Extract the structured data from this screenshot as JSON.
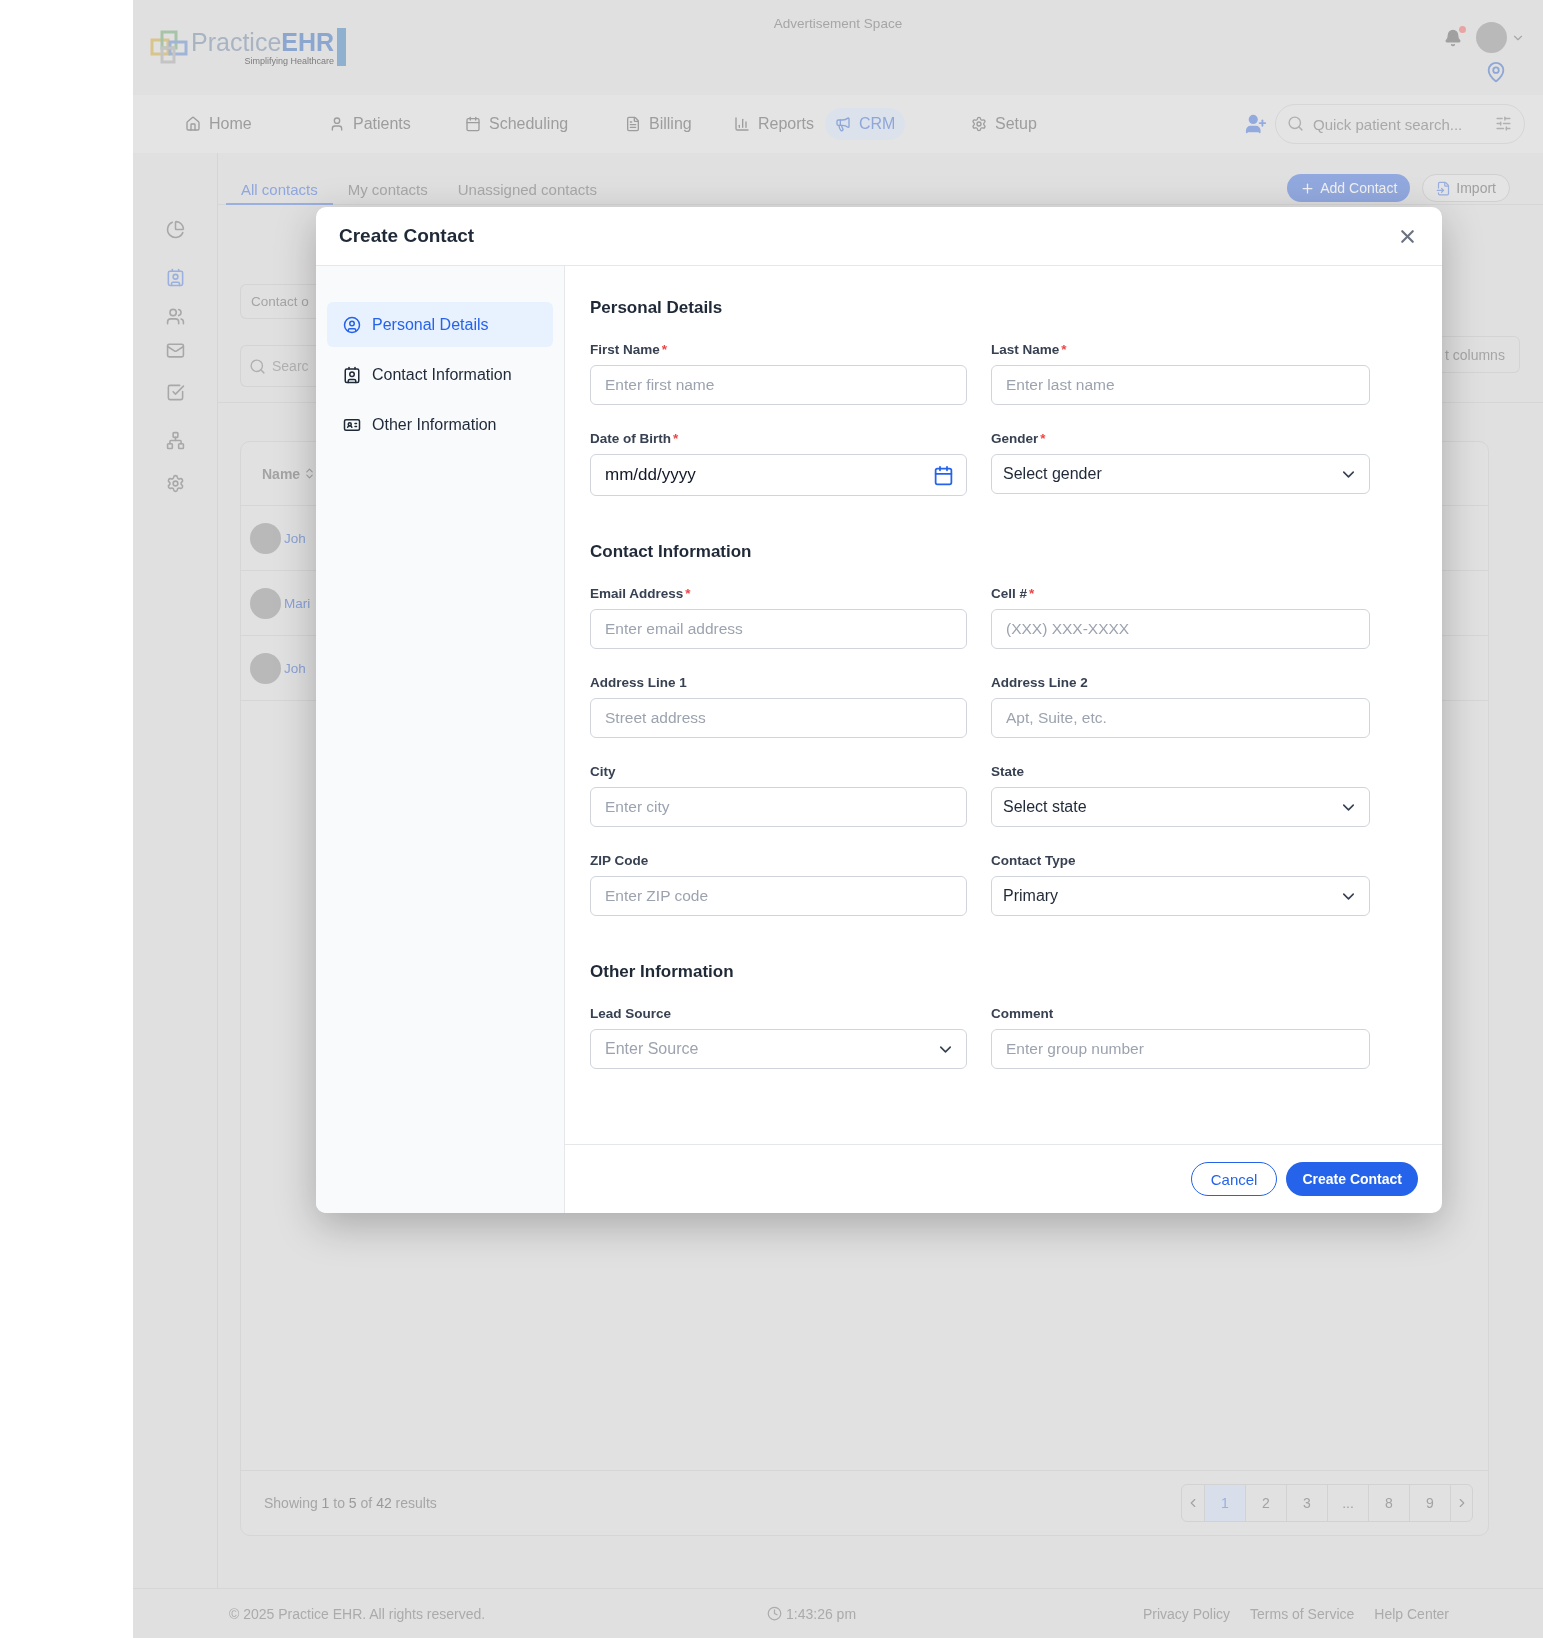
{
  "app_header": {
    "logo": {
      "name": "Practice**EHR**",
      "tagline": "Simplifying Healthcare"
    },
    "ad_text": "Advertisement Space",
    "notifications": {
      "unread": true
    }
  },
  "nav": {
    "items": [
      {
        "label": "Home",
        "selected": false
      },
      {
        "label": "Patients",
        "selected": false
      },
      {
        "label": "Scheduling",
        "selected": false
      },
      {
        "label": "Billing",
        "selected": false
      },
      {
        "label": "Reports",
        "selected": false
      },
      {
        "label": "CRM",
        "selected": true
      },
      {
        "label": "Setup",
        "selected": false
      }
    ],
    "search": {
      "placeholder": "Quick patient search..."
    }
  },
  "sidebar": {
    "items": [
      {
        "selected": false
      },
      {
        "selected": true
      },
      {
        "selected": false
      },
      {
        "selected": false
      },
      {
        "selected": false
      },
      {
        "selected": false
      },
      {
        "selected": false
      }
    ]
  },
  "contacts_page": {
    "tabs": [
      {
        "label": "All contacts",
        "selected": true
      },
      {
        "label": "My contacts",
        "selected": false
      },
      {
        "label": "Unassigned contacts",
        "selected": false
      }
    ],
    "actions": [
      {
        "label": "Add Contact",
        "kind": "primary"
      },
      {
        "label": "Import",
        "kind": "secondary"
      }
    ],
    "filter_field": "Contact o",
    "search_placeholder": "Searc",
    "columns_button": "t columns",
    "table": {
      "columns": [
        "Name"
      ],
      "rows": [
        {
          "name": "Joh"
        },
        {
          "name": "Mari"
        },
        {
          "name": "Joh"
        }
      ],
      "summary": "Showing **1** to **5** of **42** results",
      "pages": [
        {
          "label": "1",
          "selected": true
        },
        {
          "label": "2",
          "selected": false
        },
        {
          "label": "3",
          "selected": false
        },
        {
          "label": "...",
          "selected": false
        },
        {
          "label": "8",
          "selected": false
        },
        {
          "label": "9",
          "selected": false
        }
      ]
    }
  },
  "footer": {
    "copyright": "© 2025 Practice EHR. All rights reserved.",
    "time": "1:43:26 pm",
    "links": [
      "Privacy Policy",
      "Terms of Service",
      "Help Center"
    ]
  },
  "modal": {
    "title": "Create Contact",
    "nav": [
      {
        "label": "Personal Details",
        "selected": true
      },
      {
        "label": "Contact Information",
        "selected": false
      },
      {
        "label": "Other Information",
        "selected": false
      }
    ],
    "sections": [
      {
        "title": "Personal Details",
        "fields": [
          {
            "kind": "text",
            "label": "First Name",
            "required_mark": "*",
            "placeholder": "Enter first name"
          },
          {
            "kind": "text",
            "label": "Last Name",
            "required_mark": "*",
            "placeholder": "Enter last name"
          },
          {
            "kind": "date",
            "label": "Date of Birth",
            "required_mark": "*",
            "value": "mm/dd/yyyy"
          },
          {
            "kind": "select",
            "label": "Gender",
            "required_mark": "*",
            "value": "Select gender"
          }
        ]
      },
      {
        "title": "Contact Information",
        "fields": [
          {
            "kind": "text",
            "label": "Email Address",
            "required_mark": "*",
            "placeholder": "Enter email address"
          },
          {
            "kind": "text",
            "label": "Cell #",
            "required_mark": "*",
            "placeholder": "(XXX) XXX-XXXX"
          },
          {
            "kind": "text",
            "label": "Address Line 1",
            "placeholder": "Street address"
          },
          {
            "kind": "text",
            "label": "Address Line 2",
            "placeholder": "Apt, Suite, etc."
          },
          {
            "kind": "text",
            "label": "City",
            "placeholder": "Enter city"
          },
          {
            "kind": "select",
            "label": "State",
            "value": "Select state"
          },
          {
            "kind": "text",
            "label": "ZIP Code",
            "placeholder": "Enter ZIP code"
          },
          {
            "kind": "select",
            "label": "Contact Type",
            "value": "Primary"
          }
        ]
      },
      {
        "title": "Other Information",
        "fields": [
          {
            "kind": "select",
            "label": "Lead Source",
            "placeholder": "Enter Source"
          },
          {
            "kind": "text",
            "label": "Comment",
            "placeholder": "Enter group number"
          }
        ]
      }
    ],
    "buttons": [
      {
        "label": "Cancel",
        "kind": "secondary"
      },
      {
        "label": "Create Contact",
        "kind": "primary"
      }
    ]
  }
}
